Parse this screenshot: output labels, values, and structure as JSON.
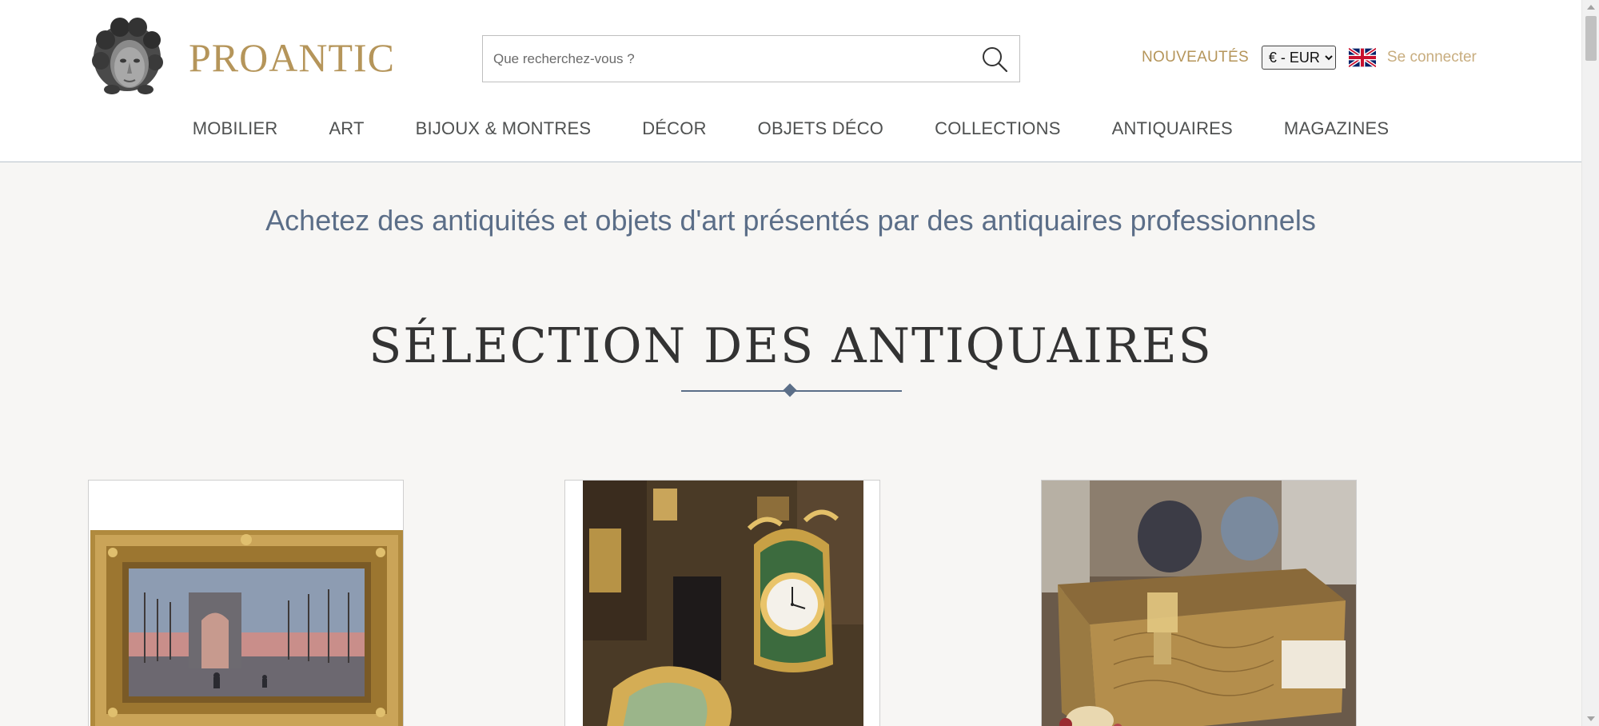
{
  "header": {
    "logo_text": "PROANTIC",
    "search_placeholder": "Que recherchez-vous ?",
    "new_label": "NOUVEAUTÉS",
    "currency_selected": "€ - EUR",
    "login_label": "Se connecter",
    "language_flag": "uk-flag-icon"
  },
  "nav": {
    "items": [
      "MOBILIER",
      "ART",
      "BIJOUX & MONTRES",
      "DÉCOR",
      "OBJETS DÉCO",
      "COLLECTIONS",
      "ANTIQUAIRES",
      "MAGAZINES"
    ]
  },
  "main": {
    "tagline": "Achetez des antiquités et objets d'art présentés par des antiquaires professionnels",
    "section_title": "SÉLECTION DES ANTIQUAIRES",
    "cards": [
      {
        "subject": "painting-arc-de-triomphe-gilt-frame"
      },
      {
        "subject": "gilt-bronze-clock-antique-shop"
      },
      {
        "subject": "engraved-brass-casket"
      }
    ]
  },
  "colors": {
    "brand_gold": "#b5955a",
    "login_gold": "#c8ad7f",
    "tagline_blue": "#5b6e88",
    "nav_text": "#4f5151",
    "background": "#f7f6f4"
  }
}
